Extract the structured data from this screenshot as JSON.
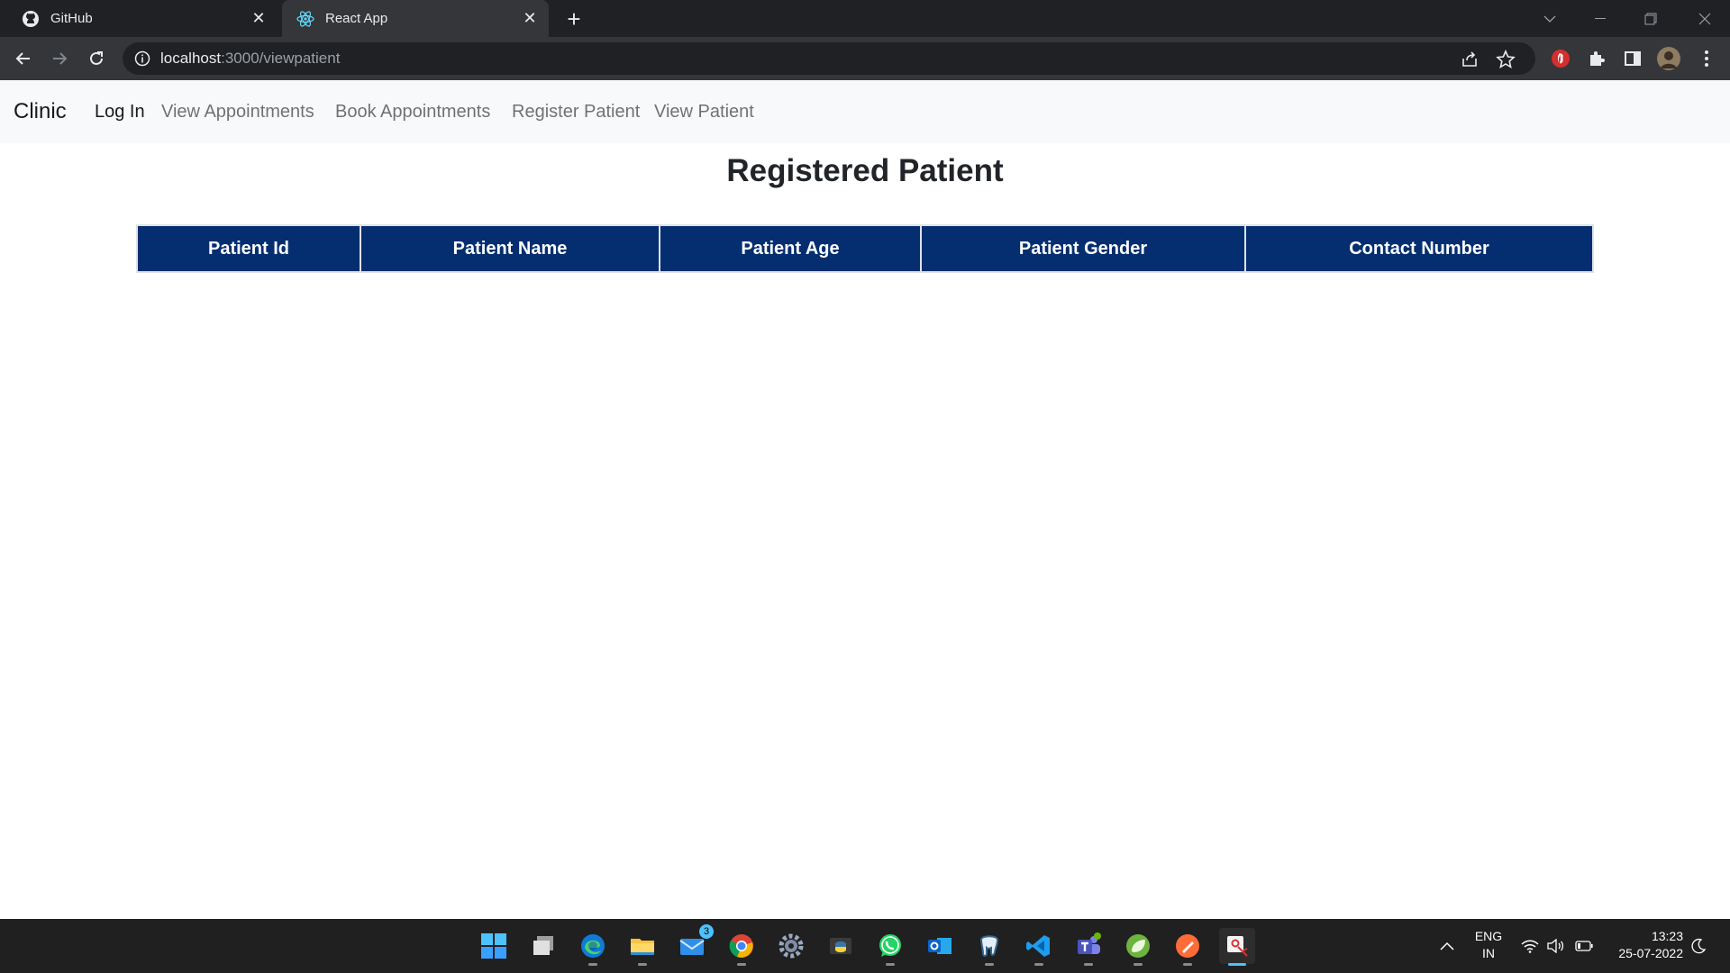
{
  "browser": {
    "tabs": [
      {
        "label": "GitHub",
        "icon": "github-icon"
      },
      {
        "label": "React App",
        "icon": "react-icon",
        "active": true
      }
    ],
    "url_host": "localhost",
    "url_path": ":3000/viewpatient"
  },
  "app": {
    "brand": "Clinic",
    "nav": [
      {
        "label": "Log In",
        "active": true
      },
      {
        "label": "View Appointments"
      },
      {
        "label": "Book Appointments"
      },
      {
        "label": "Register Patient"
      },
      {
        "label": "View Patient"
      }
    ],
    "title": "Registered Patient",
    "table": {
      "columns": [
        "Patient Id",
        "Patient Name",
        "Patient Age",
        "Patient Gender",
        "Contact Number"
      ],
      "rows": []
    },
    "colors": {
      "table_header_bg": "#042e6f",
      "navbar_bg": "#f8f9fa"
    }
  },
  "taskbar": {
    "apps": [
      "windows-start-icon",
      "task-view-icon",
      "edge-icon",
      "file-explorer-icon",
      "mail-icon",
      "chrome-icon",
      "settings-icon",
      "python-icon",
      "whatsapp-icon",
      "outlook-icon",
      "postgresql-icon",
      "vscode-icon",
      "teams-icon",
      "spring-icon",
      "postman-icon",
      "snipping-tool-icon"
    ],
    "mail_badge": "3",
    "lang_line1": "ENG",
    "lang_line2": "IN",
    "time": "13:23",
    "date": "25-07-2022"
  }
}
